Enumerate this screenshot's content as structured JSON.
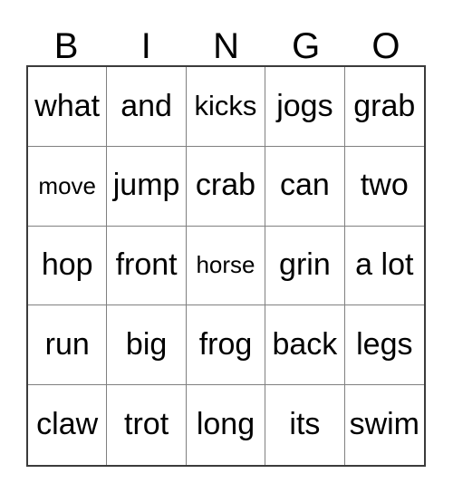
{
  "card": {
    "title_letters": [
      "B",
      "I",
      "N",
      "G",
      "O"
    ],
    "grid_size": "5x5",
    "colors": {
      "background": "#ffffff",
      "text": "#000000",
      "outer_border": "#3b3b3b",
      "inner_line": "#808080"
    },
    "rows": [
      [
        {
          "text": "what",
          "size": "normal"
        },
        {
          "text": "and",
          "size": "normal"
        },
        {
          "text": "kicks",
          "size": "mid"
        },
        {
          "text": "jogs",
          "size": "normal"
        },
        {
          "text": "grab",
          "size": "normal"
        }
      ],
      [
        {
          "text": "move",
          "size": "small"
        },
        {
          "text": "jump",
          "size": "normal"
        },
        {
          "text": "crab",
          "size": "normal"
        },
        {
          "text": "can",
          "size": "normal"
        },
        {
          "text": "two",
          "size": "normal"
        }
      ],
      [
        {
          "text": "hop",
          "size": "normal"
        },
        {
          "text": "front",
          "size": "normal"
        },
        {
          "text": "horse",
          "size": "small"
        },
        {
          "text": "grin",
          "size": "normal"
        },
        {
          "text": "a lot",
          "size": "normal"
        }
      ],
      [
        {
          "text": "run",
          "size": "normal"
        },
        {
          "text": "big",
          "size": "normal"
        },
        {
          "text": "frog",
          "size": "normal"
        },
        {
          "text": "back",
          "size": "normal"
        },
        {
          "text": "legs",
          "size": "normal"
        }
      ],
      [
        {
          "text": "claw",
          "size": "normal"
        },
        {
          "text": "trot",
          "size": "normal"
        },
        {
          "text": "long",
          "size": "normal"
        },
        {
          "text": "its",
          "size": "normal"
        },
        {
          "text": "swim",
          "size": "normal"
        }
      ]
    ]
  }
}
